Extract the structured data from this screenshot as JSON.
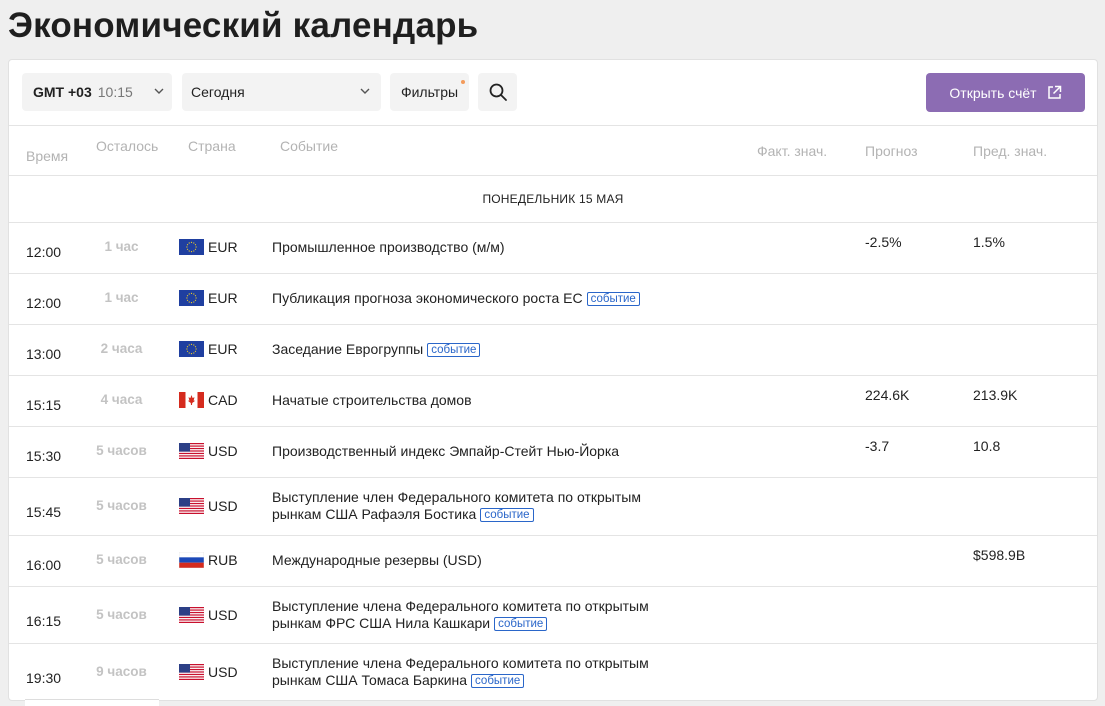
{
  "page": {
    "title": "Экономический календарь"
  },
  "toolbar": {
    "timezone_label": "GMT +03",
    "timezone_time": "10:15",
    "day_value": "Сегодня",
    "filters_label": "Фильтры",
    "open_account_label": "Открыть счёт"
  },
  "table": {
    "columns": {
      "time": "Время",
      "remaining": "Осталось",
      "country": "Страна",
      "event": "Событие",
      "actual": "Факт. знач.",
      "forecast": "Прогноз",
      "previous": "Пред. знач."
    },
    "date_label": "ПОНЕДЕЛЬНИК 15 МАЯ",
    "rows": [
      {
        "time": "12:00",
        "remaining": "1 час",
        "currency": "EUR",
        "flag": "eu-flag-icon",
        "event": "Промышленное производство (м/м)",
        "tag": "",
        "actual": "",
        "forecast": "-2.5%",
        "previous": "1.5%"
      },
      {
        "time": "12:00",
        "remaining": "1 час",
        "currency": "EUR",
        "flag": "eu-flag-icon",
        "event": "Публикация прогноза экономического роста ЕС",
        "tag": "событие",
        "actual": "",
        "forecast": "",
        "previous": ""
      },
      {
        "time": "13:00",
        "remaining": "2 часа",
        "currency": "EUR",
        "flag": "eu-flag-icon",
        "event": "Заседание Еврогруппы",
        "tag": "событие",
        "actual": "",
        "forecast": "",
        "previous": ""
      },
      {
        "time": "15:15",
        "remaining": "4 часа",
        "currency": "CAD",
        "flag": "canada-flag-icon",
        "event": "Начатые строительства домов",
        "tag": "",
        "actual": "",
        "forecast": "224.6K",
        "previous": "213.9K"
      },
      {
        "time": "15:30",
        "remaining": "5 часов",
        "currency": "USD",
        "flag": "usa-flag-icon",
        "event": "Производственный индекс Эмпайр-Стейт Нью-Йорка",
        "tag": "",
        "actual": "",
        "forecast": "-3.7",
        "previous": "10.8"
      },
      {
        "time": "15:45",
        "remaining": "5 часов",
        "currency": "USD",
        "flag": "usa-flag-icon",
        "event_line1": "Выступление член Федерального комитета по открытым",
        "event_line2": "рынкам США Рафаэля Бостика",
        "tag": "событие",
        "actual": "",
        "forecast": "",
        "previous": ""
      },
      {
        "time": "16:00",
        "remaining": "5 часов",
        "currency": "RUB",
        "flag": "russia-flag-icon",
        "event": "Международные резервы (USD)",
        "tag": "",
        "actual": "",
        "forecast": "",
        "previous": "$598.9B"
      },
      {
        "time": "16:15",
        "remaining": "5 часов",
        "currency": "USD",
        "flag": "usa-flag-icon",
        "event_line1": "Выступление члена Федерального комитета по открытым",
        "event_line2": "рынкам ФРС США Нила Кашкари",
        "tag": "событие",
        "actual": "",
        "forecast": "",
        "previous": ""
      },
      {
        "time": "19:30",
        "remaining": "9 часов",
        "currency": "USD",
        "flag": "usa-flag-icon",
        "event_line1": "Выступление члена Федерального комитета по открытым",
        "event_line2": "рынкам США Томаса Баркина",
        "tag": "событие",
        "actual": "",
        "forecast": "",
        "previous": ""
      }
    ]
  },
  "colors": {
    "accent": "#8c6cb3",
    "tag": "#2a66c9",
    "muted": "#b3b3b3"
  }
}
